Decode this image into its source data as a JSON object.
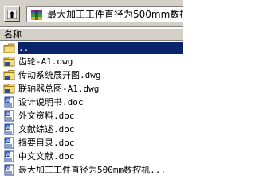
{
  "toolbar": {
    "path_text": "最大加工工件直径为500mm数控"
  },
  "header": {
    "column_name": "名称"
  },
  "files": [
    {
      "name": "..",
      "icon": "folder-up-icon",
      "selected": true
    },
    {
      "name": "齿轮-A1.dwg",
      "icon": "dwg-file-icon"
    },
    {
      "name": "传动系统展开图.dwg",
      "icon": "dwg-file-icon"
    },
    {
      "name": "联轴器总图-A1.dwg",
      "icon": "dwg-file-icon"
    },
    {
      "name": "设计说明书.doc",
      "icon": "doc-file-icon"
    },
    {
      "name": "外文资料.doc",
      "icon": "doc-file-icon"
    },
    {
      "name": "文献综述.doc",
      "icon": "doc-file-icon"
    },
    {
      "name": "摘要目录.doc",
      "icon": "doc-file-icon"
    },
    {
      "name": "中文文献.doc",
      "icon": "doc-file-icon"
    },
    {
      "name": "最大加工工件直径为500mm数控机...",
      "icon": "doc-file-icon"
    }
  ],
  "colors": {
    "chrome": "#d4d0c8",
    "selection": "#0a246a"
  }
}
